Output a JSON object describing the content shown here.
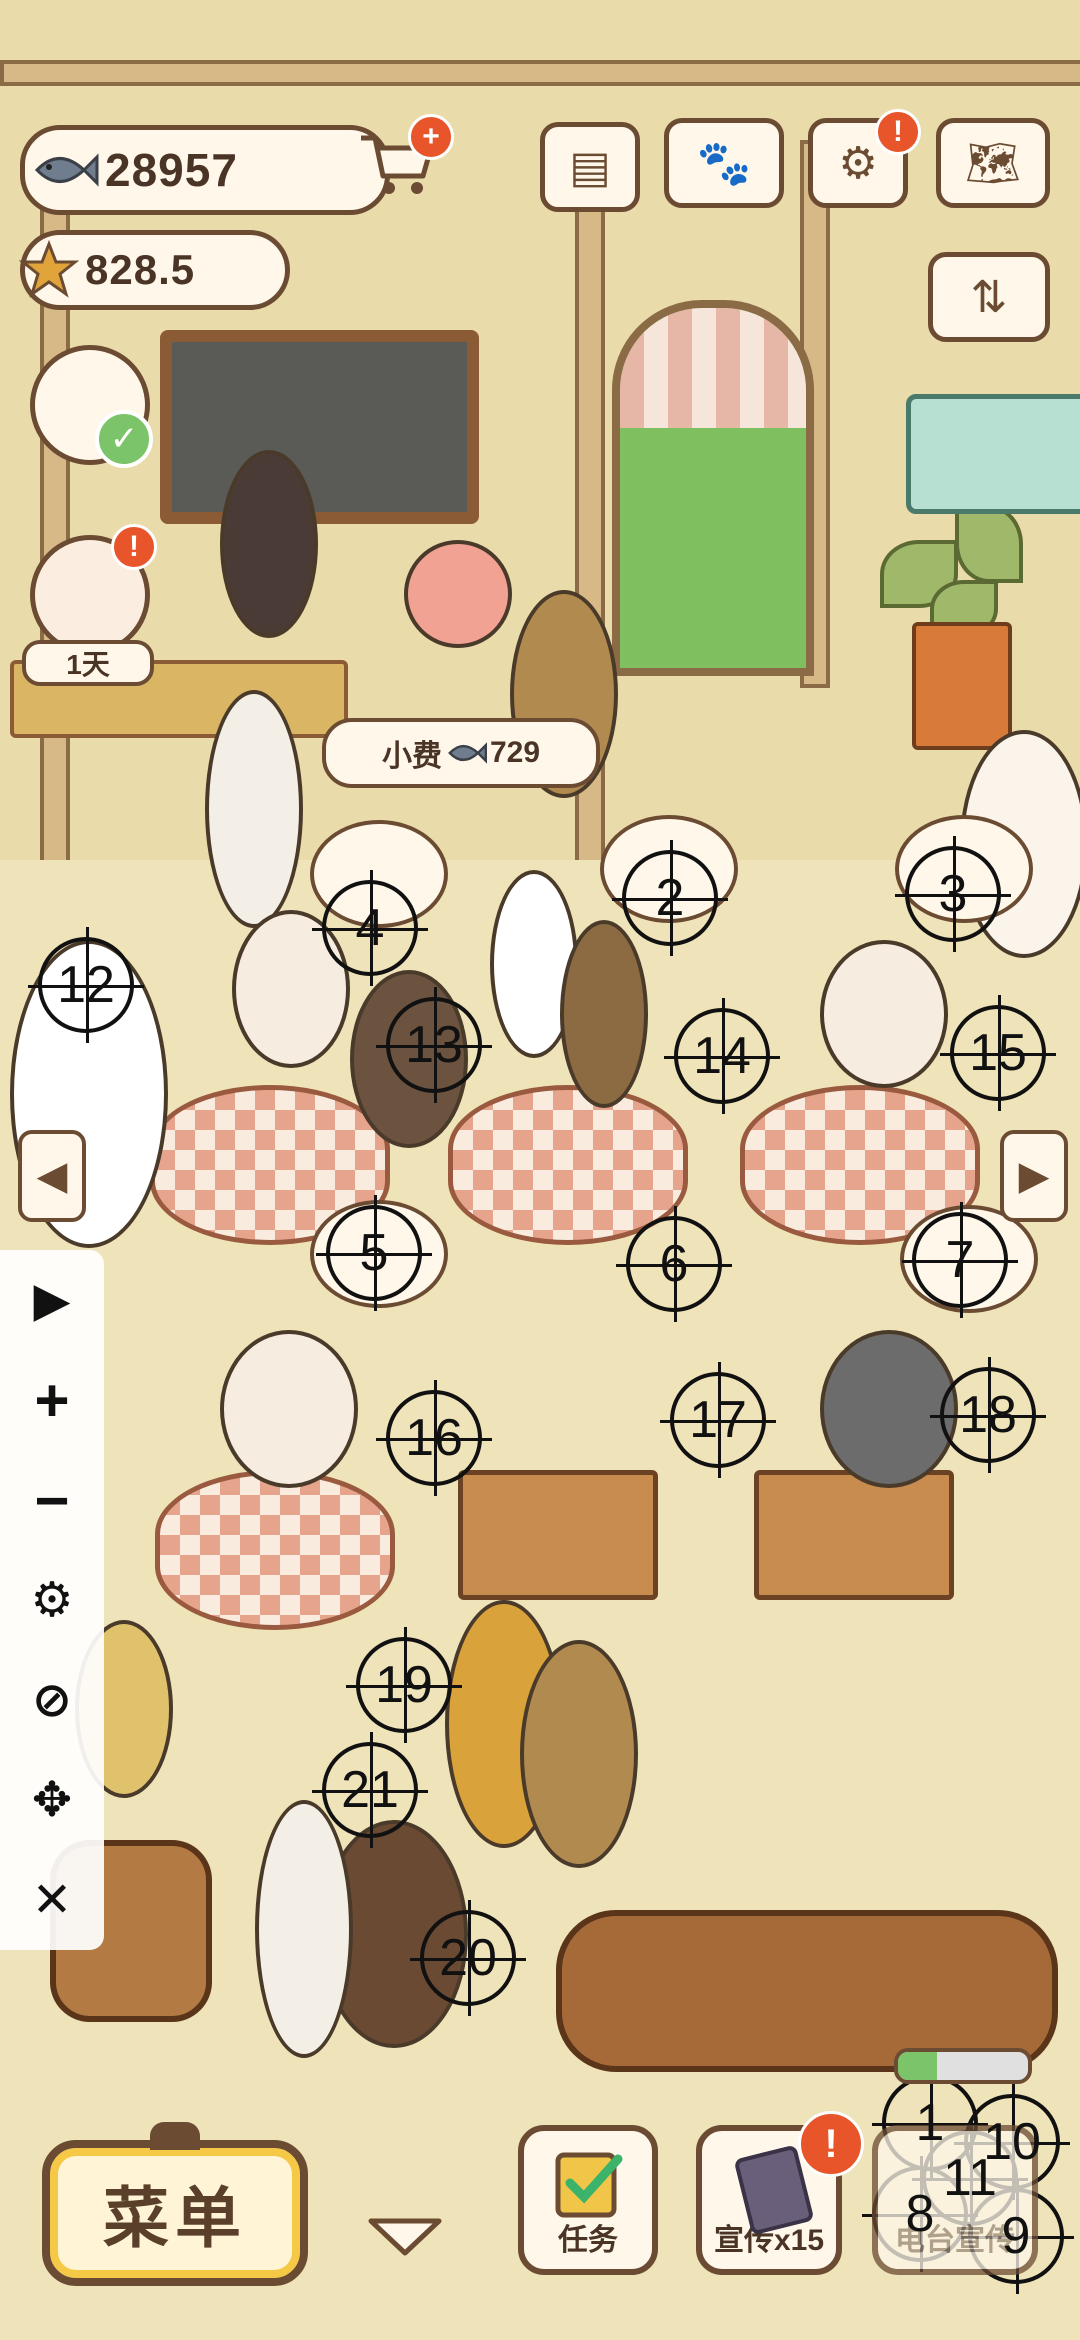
{
  "hud": {
    "fish_amount": "28957",
    "star_amount": "828.5",
    "staff_day_label": "1天",
    "tip_label": "小费",
    "tip_amount": "729"
  },
  "top_buttons": [
    {
      "name": "newspaper-icon"
    },
    {
      "name": "paw-book-icon"
    },
    {
      "name": "settings-gear-icon"
    },
    {
      "name": "map-icon"
    }
  ],
  "markers": [
    "1",
    "2",
    "3",
    "4",
    "5",
    "6",
    "7",
    "8",
    "9",
    "10",
    "11",
    "12",
    "13",
    "14",
    "15",
    "16",
    "17",
    "18",
    "19",
    "20",
    "21"
  ],
  "toolbar": {
    "items": [
      {
        "name": "play-icon",
        "glyph": "▶"
      },
      {
        "name": "zoom-in-icon",
        "glyph": "+"
      },
      {
        "name": "zoom-out-icon",
        "glyph": "−"
      },
      {
        "name": "settings-icon",
        "glyph": "⚙"
      },
      {
        "name": "hide-icon",
        "glyph": "⊘"
      },
      {
        "name": "move-icon",
        "glyph": "✥"
      },
      {
        "name": "close-icon",
        "glyph": "✕"
      }
    ]
  },
  "bottom": {
    "menu_label": "菜单",
    "task_label": "任务",
    "promo_label": "宣传x15",
    "radio_label": "电台宣传"
  },
  "colors": {
    "badge": "#e8552a",
    "outline": "#6b4c33"
  }
}
